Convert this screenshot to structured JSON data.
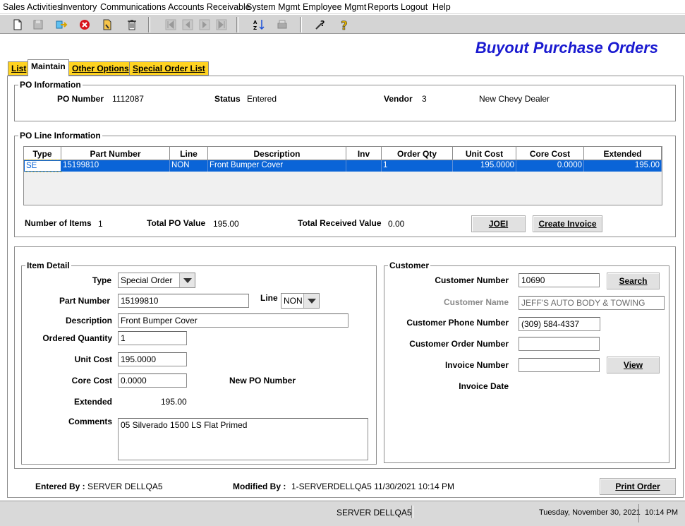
{
  "menu": [
    "Sales Activities",
    "Inventory",
    "Communications",
    "Accounts Receivable",
    "System Mgmt",
    "Employee Mgmt",
    "Reports",
    "Logout",
    "Help"
  ],
  "page_title": "Buyout Purchase Orders",
  "tabs": [
    "List",
    "Maintain",
    "Other Options",
    "Special Order List"
  ],
  "po_info": {
    "legend": "PO Information",
    "po_number_label": "PO Number",
    "po_number": "1112087",
    "status_label": "Status",
    "status": "Entered",
    "vendor_label": "Vendor",
    "vendor_id": "3",
    "vendor_name": "New Chevy Dealer"
  },
  "po_lines": {
    "legend": "PO Line Information",
    "columns": [
      "Type",
      "Part Number",
      "Line",
      "Description",
      "Inv",
      "Order Qty",
      "Unit Cost",
      "Core Cost",
      "Extended"
    ],
    "rows": [
      [
        "SE",
        "15199810",
        "NON",
        "Front Bumper Cover",
        "",
        "1",
        "195.0000",
        "0.0000",
        "195.00"
      ]
    ],
    "num_items_label": "Number of Items",
    "num_items": "1",
    "total_po_label": "Total PO Value",
    "total_po": "195.00",
    "total_received_label": "Total Received Value",
    "total_received": "0.00",
    "joei_button": "JOEI",
    "create_invoice_button": "Create Invoice"
  },
  "item_detail": {
    "legend": "Item Detail",
    "type_label": "Type",
    "type_value": "Special Order",
    "part_label": "Part Number",
    "part_value": "15199810",
    "line_label": "Line",
    "line_value": "NON",
    "desc_label": "Description",
    "desc_value": "Front Bumper Cover",
    "qty_label": "Ordered Quantity",
    "qty_value": "1",
    "unit_cost_label": "Unit Cost",
    "unit_cost_value": "195.0000",
    "core_cost_label": "Core Cost",
    "core_cost_value": "0.0000",
    "new_po_label": "New PO Number",
    "extended_label": "Extended",
    "extended_value": "195.00",
    "comments_label": "Comments",
    "comments_value": "05 Silverado 1500 LS Flat Primed"
  },
  "customer": {
    "legend": "Customer",
    "number_label": "Customer Number",
    "number_value": "10690",
    "search_button": "Search",
    "name_label": "Customer Name",
    "name_value": "JEFF'S AUTO BODY & TOWING",
    "phone_label": "Customer Phone Number",
    "phone_value": "(309) 584-4337",
    "order_label": "Customer Order Number",
    "order_value": "",
    "invoice_label": "Invoice Number",
    "invoice_value": "",
    "view_button": "View",
    "invoice_date_label": "Invoice Date"
  },
  "footer": {
    "entered_by_label": "Entered By :",
    "entered_by": "SERVER DELLQA5",
    "modified_by_label": "Modified By :",
    "modified_by": "1-SERVERDELLQA5 11/30/2021 10:14 PM",
    "print_button": "Print Order"
  },
  "statusbar": {
    "server": "SERVER DELLQA5",
    "date": "Tuesday, November 30, 2021",
    "time": "10:14 PM"
  }
}
